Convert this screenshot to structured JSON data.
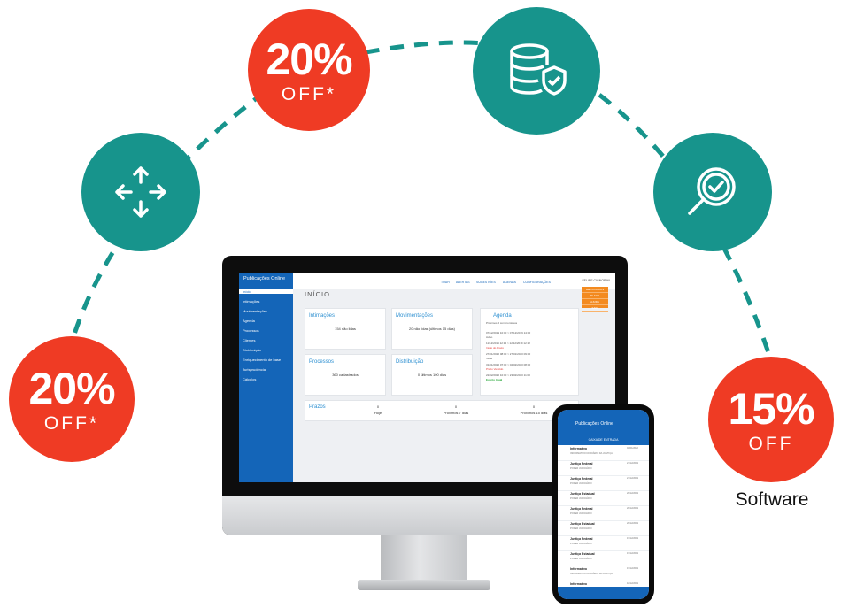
{
  "badges": {
    "left_bottom": {
      "pct": "20%",
      "off": "OFF*"
    },
    "top_left": {
      "pct": "20%",
      "off": "OFF*"
    },
    "right_bottom": {
      "pct": "15%",
      "off": "OFF",
      "caption": "Software"
    }
  },
  "colors": {
    "red": "#ef3b24",
    "teal": "#17948c",
    "app_blue": "#1465b8"
  },
  "icons": [
    "arrows-move-icon",
    "database-shield-icon",
    "magnifier-check-icon"
  ],
  "app": {
    "logo": "Publicações Online",
    "sidebar": [
      "Início",
      "Intimações",
      "Movimentações",
      "Agenda",
      "Processos",
      "Clientes",
      "Distribuição",
      "Enriquecimento de base",
      "Jurisprudência",
      "Cálculos"
    ],
    "top_menu": [
      "TOUR",
      "ALERTAS",
      "SUGESTÕES",
      "AGENDA",
      "CONFIGURAÇÕES"
    ],
    "user": "FELIPE CIGNORINI",
    "orange_menu": [
      "MEUS DADOS",
      "PLANO",
      "AJUDA",
      "SAIR"
    ],
    "page_title": "INÍCIO",
    "cards": [
      {
        "title": "Intimações",
        "value": "154 não lidas"
      },
      {
        "title": "Movimentações",
        "value": "20 não lidas (últimos 15 dias)"
      },
      {
        "title": "Processos",
        "value": "360 cadastrados"
      },
      {
        "title": "Distribuição",
        "value": "0 últimos 100 dias"
      }
    ],
    "agenda": {
      "title": "Agenda",
      "subtitle": "Próximos 5 compromissos",
      "items": [
        {
          "date": "07/12/2019 10:00 > 07/12/2019 14:00",
          "tag": "Aviso"
        },
        {
          "date": "11/12/2019 12:12 > 12/12/2019 12:12",
          "tag": "Início do Prazo"
        },
        {
          "date": "27/01/2020 08:00 > 27/01/2020 09:00",
          "tag": "Teste"
        },
        {
          "date": "31/01/2020 07:00 > 02/02/2020 08:00",
          "tag": "Prazo Vencido"
        },
        {
          "date": "22/02/2020 10:00 > 23/02/2020 11:00",
          "tag": "Evento Atual"
        }
      ]
    },
    "prazos": {
      "title": "Prazos",
      "cols": [
        {
          "value": "0",
          "label": "Hoje"
        },
        {
          "value": "0",
          "label": "Próximos 7 dias"
        },
        {
          "value": "0",
          "label": "Próximos 15 dias"
        }
      ]
    }
  },
  "phone": {
    "logo": "Publicações Online",
    "title": "CAIXA DE ENTRADA",
    "rows": [
      {
        "a": "Informativo",
        "b": "INFORMATIVO DO DIÁRIO DA JUSTIÇA",
        "d": "02/01/2020"
      },
      {
        "a": "Justiça Federal",
        "b": "PODER JUDICIÁRIO",
        "d": "21/12/2019"
      },
      {
        "a": "Justiça Federal",
        "b": "PODER JUDICIÁRIO",
        "d": "21/12/2019"
      },
      {
        "a": "Justiça Estadual",
        "b": "PODER JUDICIÁRIO",
        "d": "20/12/2019"
      },
      {
        "a": "Justiça Federal",
        "b": "PODER JUDICIÁRIO",
        "d": "20/12/2019"
      },
      {
        "a": "Justiça Estadual",
        "b": "PODER JUDICIÁRIO",
        "d": "20/12/2019"
      },
      {
        "a": "Justiça Federal",
        "b": "PODER JUDICIÁRIO",
        "d": "19/12/2019"
      },
      {
        "a": "Justiça Estadual",
        "b": "PODER JUDICIÁRIO",
        "d": "19/12/2019"
      },
      {
        "a": "Informativo",
        "b": "INFORMATIVO DO DIÁRIO DA JUSTIÇA",
        "d": "19/12/2019"
      },
      {
        "a": "Informativo",
        "b": "INFORMATIVO DO DIÁRIO DA JUSTIÇA",
        "d": "18/12/2019"
      }
    ]
  }
}
